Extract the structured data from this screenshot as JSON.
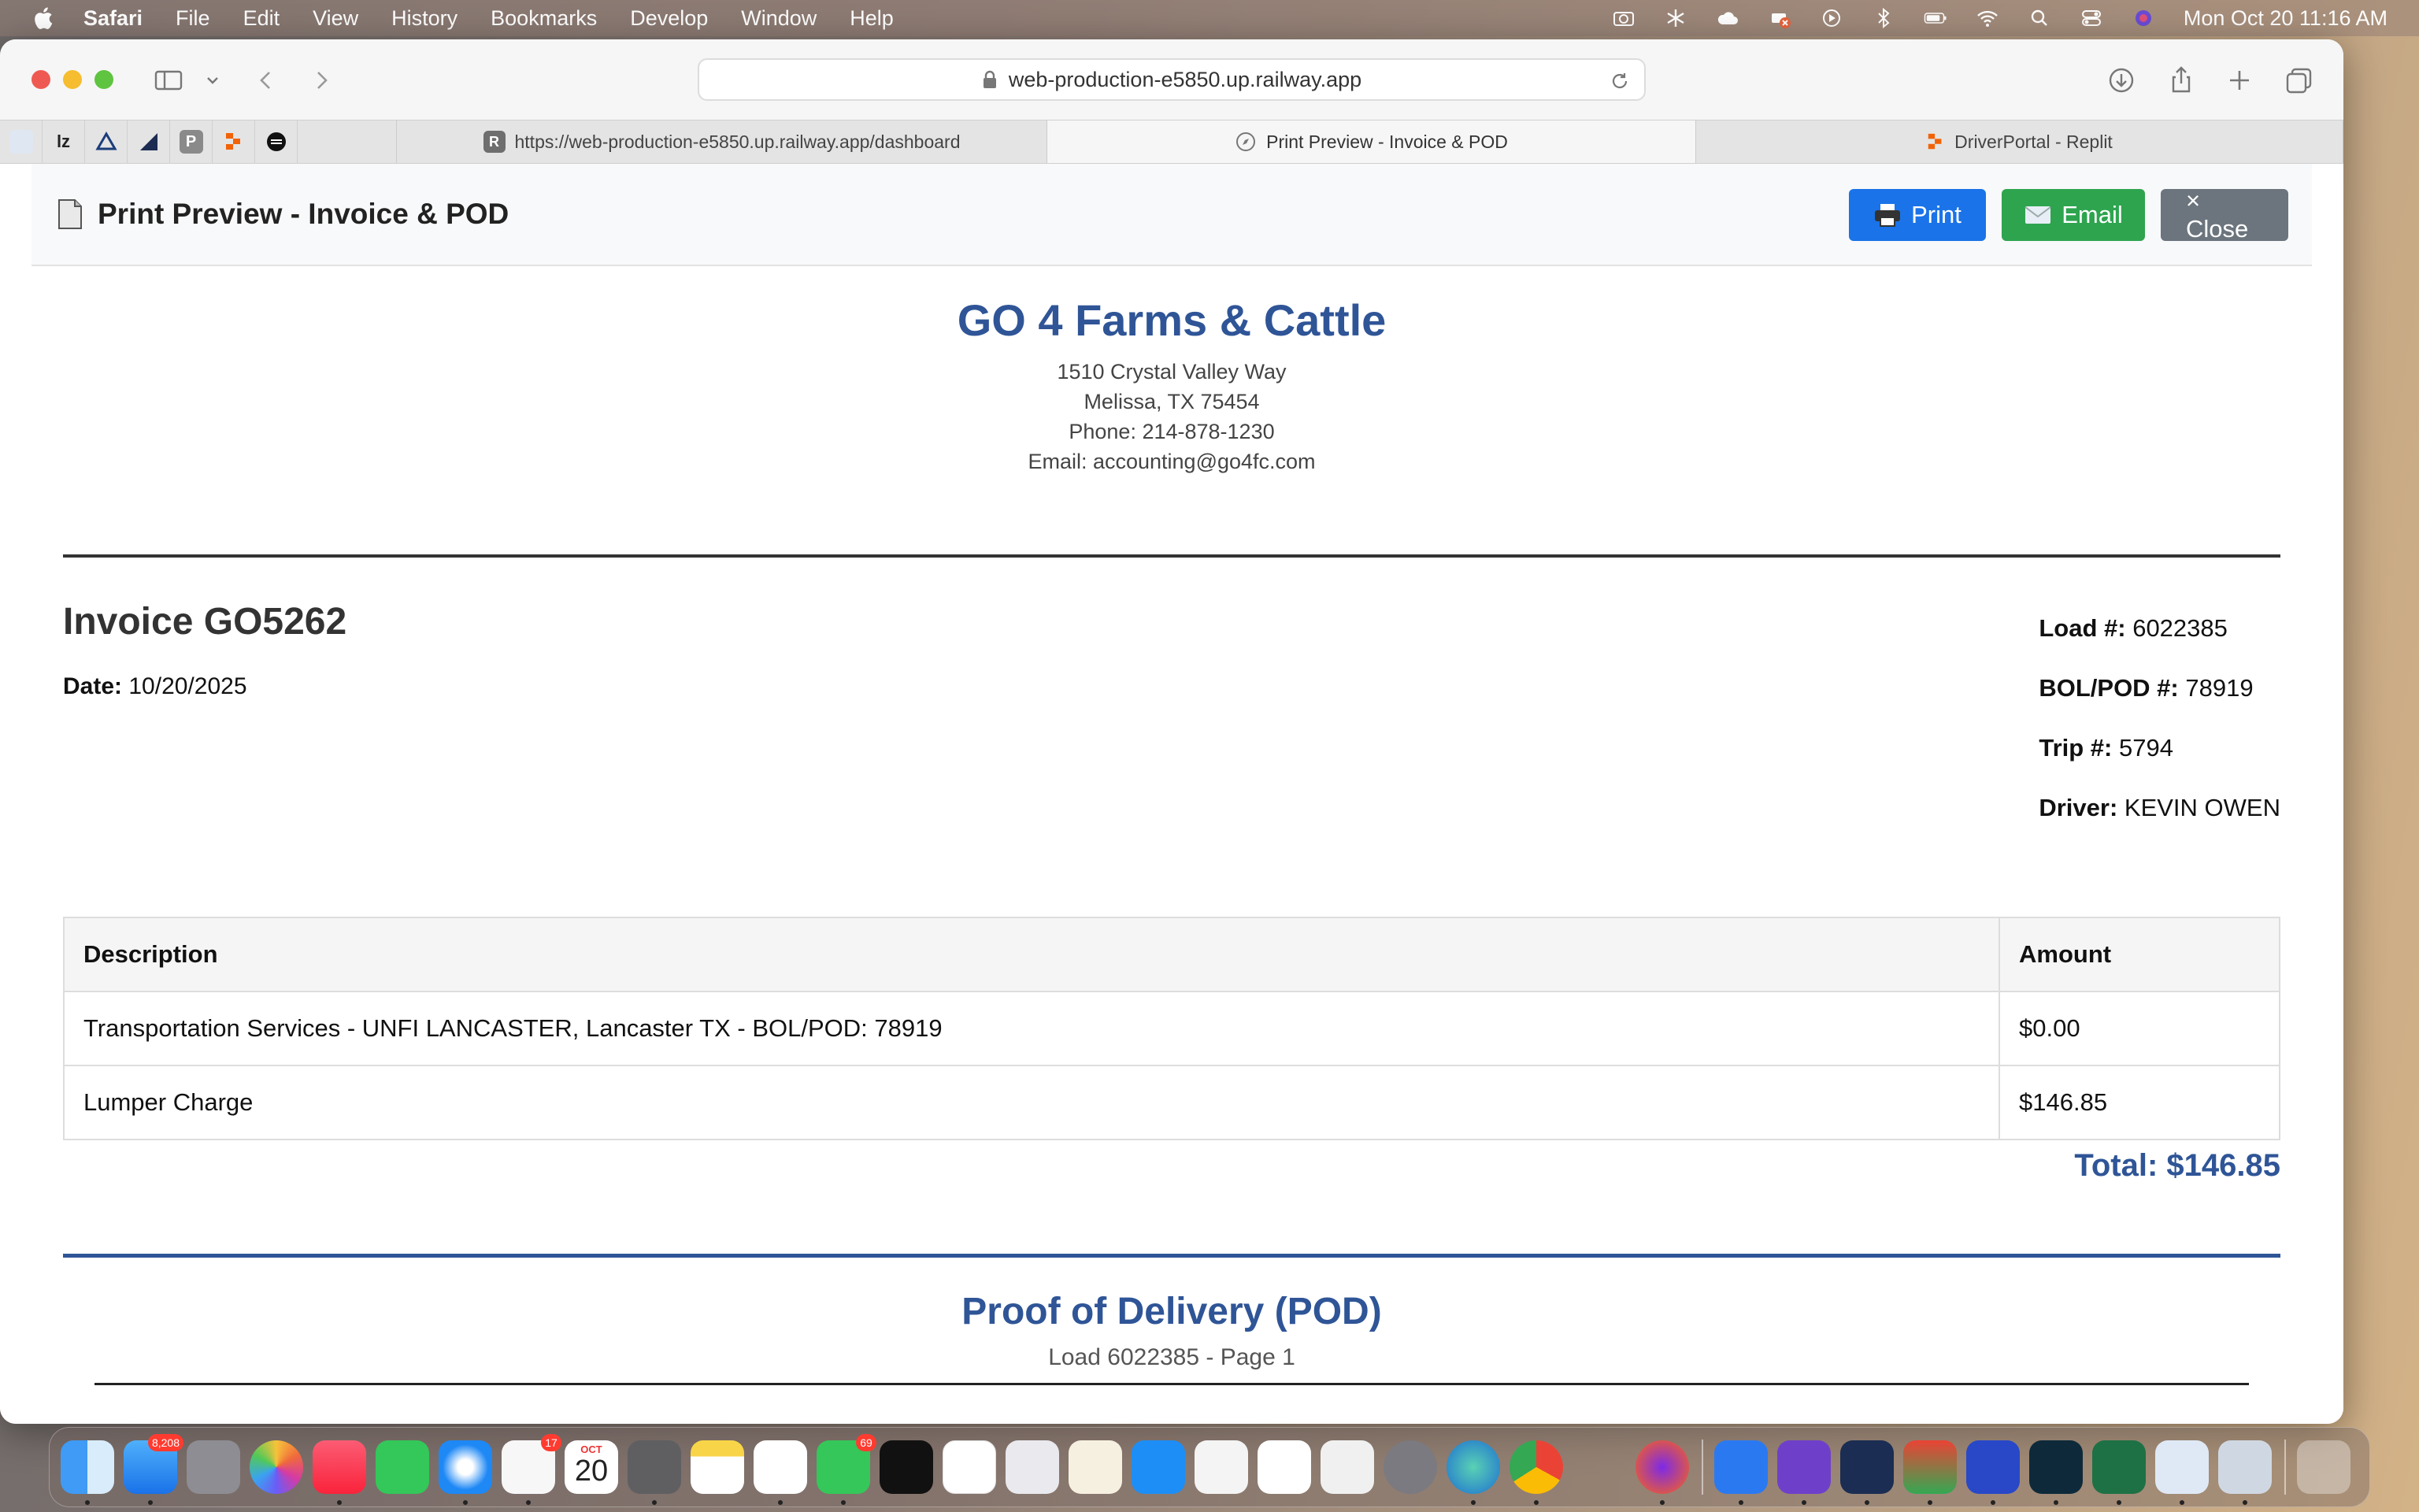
{
  "menubar": {
    "app_name": "Safari",
    "menus": [
      "File",
      "Edit",
      "View",
      "History",
      "Bookmarks",
      "Develop",
      "Window",
      "Help"
    ],
    "clock": "Mon Oct 20  11:16 AM"
  },
  "browser": {
    "url": "web-production-e5850.up.railway.app",
    "pinned_tabs": [
      "lz",
      "P"
    ],
    "tabs": [
      {
        "label": "https://web-production-e5850.up.railway.app/dashboard",
        "favicon": "R"
      },
      {
        "label": "Print Preview - Invoice & POD",
        "active": true
      },
      {
        "label": "DriverPortal - Replit"
      }
    ]
  },
  "preview": {
    "title": "Print Preview - Invoice & POD",
    "print_label": "Print",
    "email_label": "Email",
    "close_label": "× Close"
  },
  "company": {
    "name": "GO 4 Farms & Cattle",
    "address1": "1510 Crystal Valley Way",
    "address2": "Melissa, TX 75454",
    "phone": "Phone: 214-878-1230",
    "email": "Email: accounting@go4fc.com"
  },
  "invoice": {
    "title": "Invoice GO5262",
    "date_label": "Date:",
    "date": "10/20/2025",
    "load_label": "Load #:",
    "load": "6022385",
    "bol_label": "BOL/POD #:",
    "bol": "78919",
    "trip_label": "Trip #:",
    "trip": "5794",
    "driver_label": "Driver:",
    "driver": "KEVIN OWEN",
    "columns": {
      "description": "Description",
      "amount": "Amount"
    },
    "items": [
      {
        "description": "Transportation Services - UNFI LANCASTER, Lancaster TX - BOL/POD: 78919",
        "amount": "$0.00"
      },
      {
        "description": "Lumper Charge",
        "amount": "$146.85"
      }
    ],
    "total": "Total: $146.85"
  },
  "pod": {
    "title": "Proof of Delivery (POD)",
    "subtitle": "Load 6022385 - Page 1"
  },
  "dock": {
    "badges": {
      "mail": "8,208",
      "reminders": "17",
      "messages": "69"
    },
    "calendar_month": "OCT",
    "calendar_day": "20"
  },
  "colors": {
    "brand_blue": "#2f5597",
    "print_button": "#1a73e8",
    "email_button": "#2ea44f",
    "close_button": "#6c757d"
  }
}
